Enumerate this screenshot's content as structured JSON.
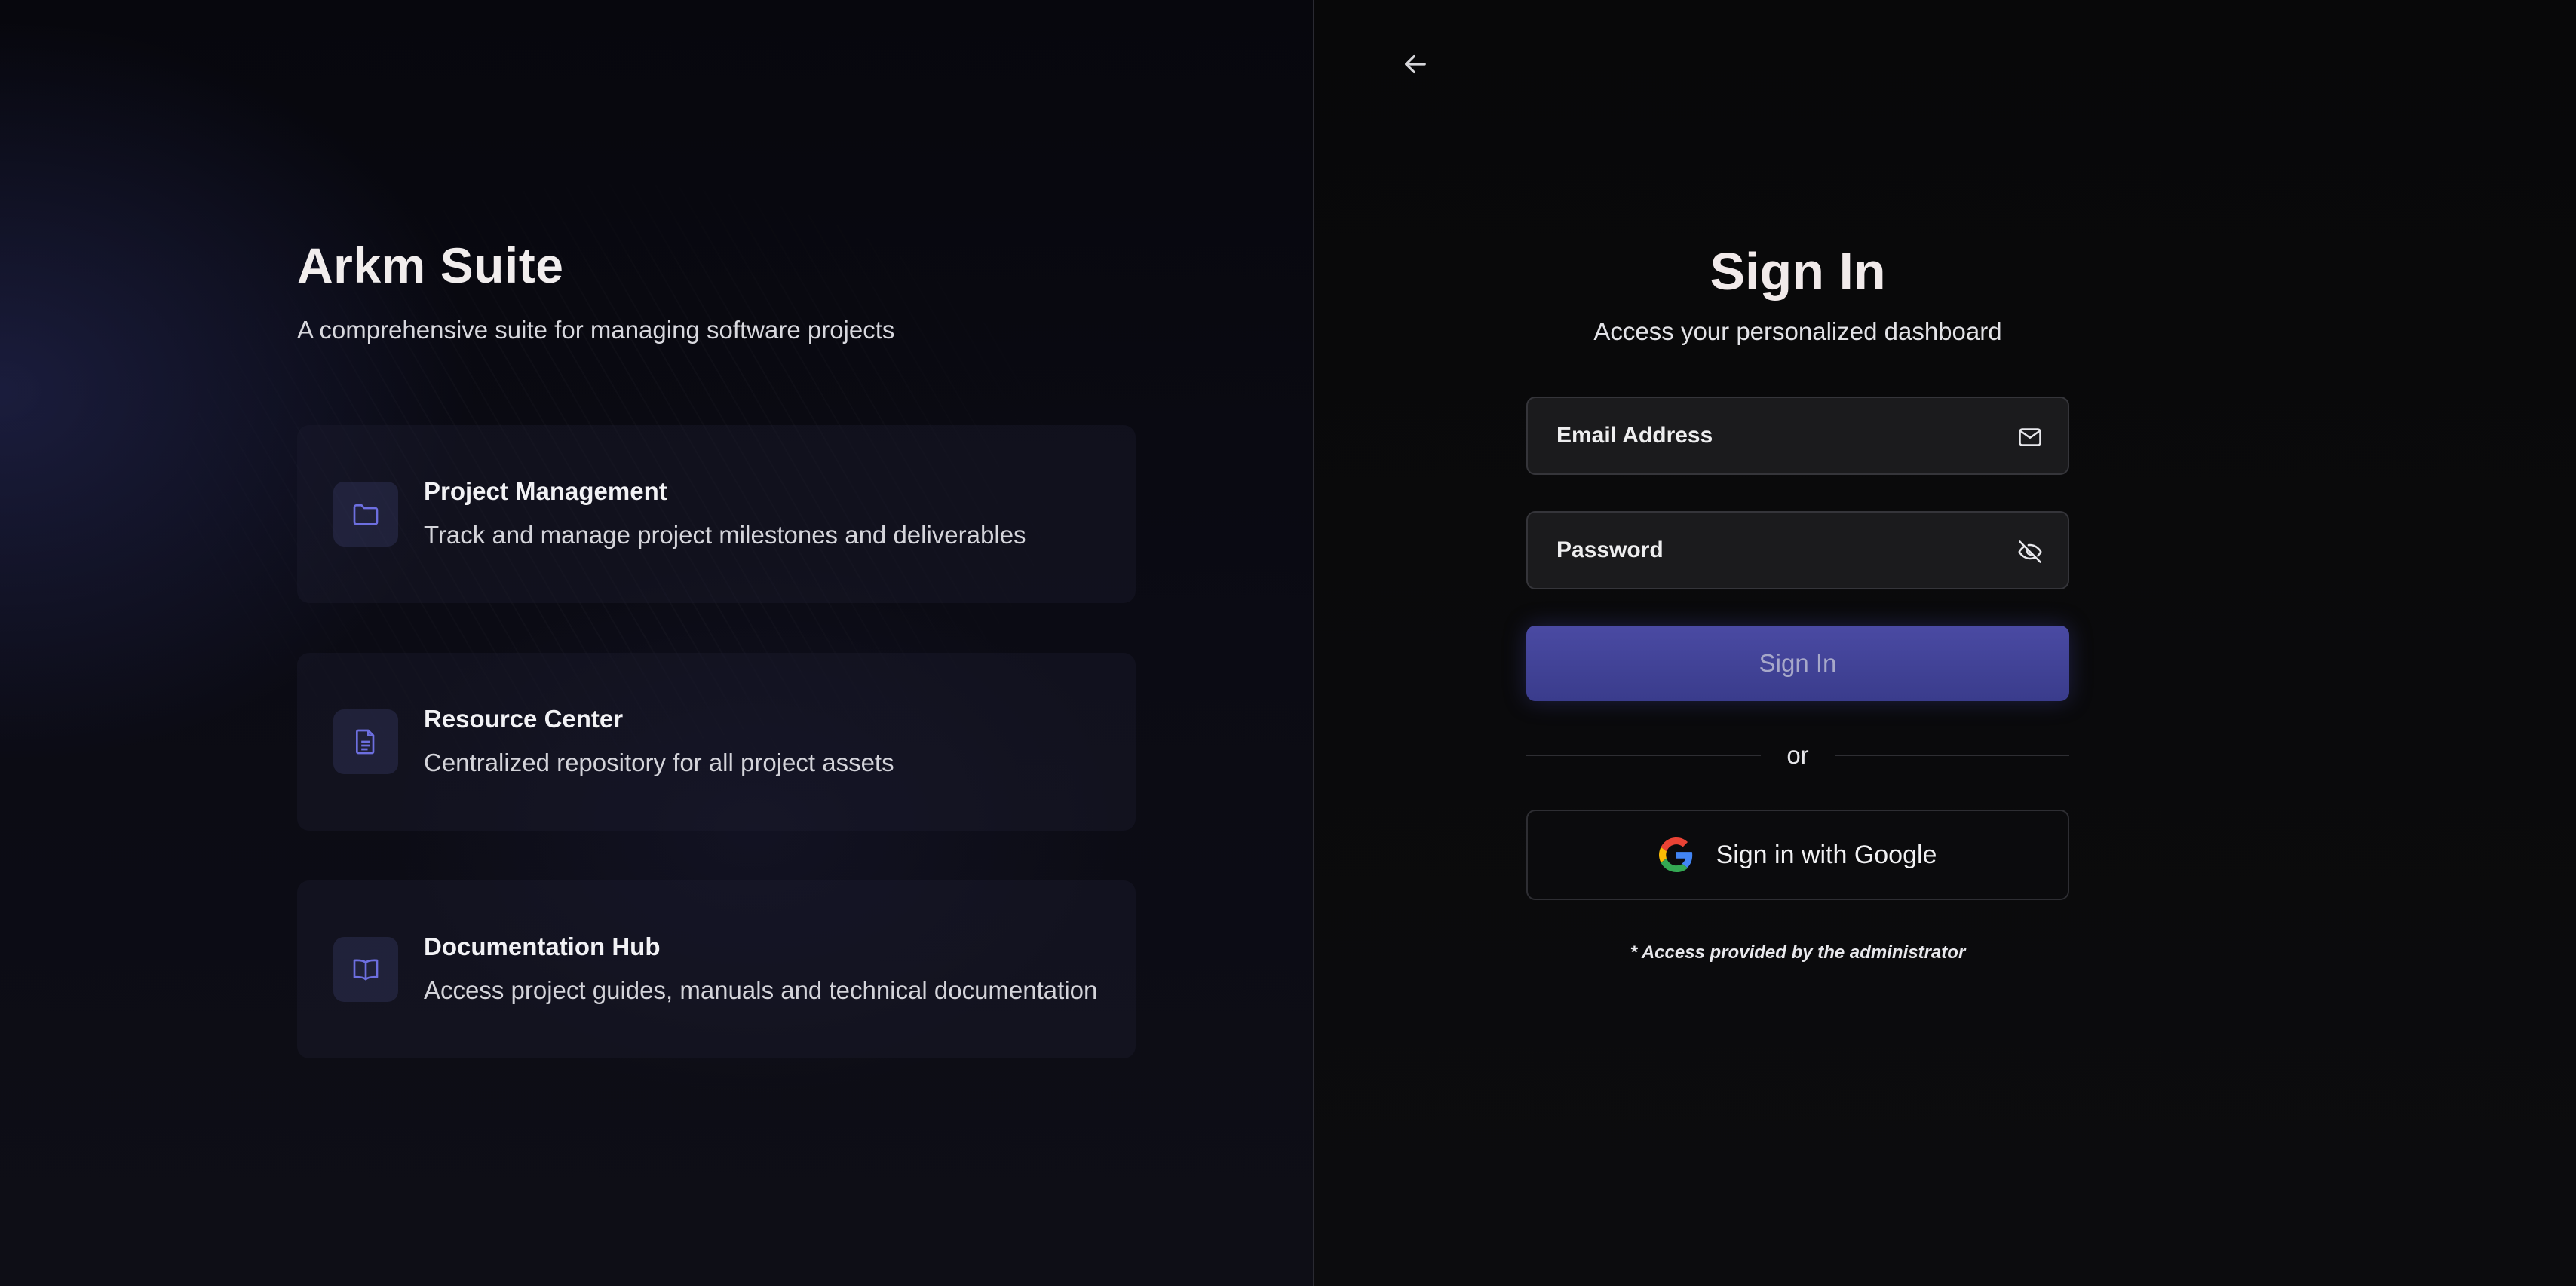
{
  "brand": {
    "title": "Arkm Suite",
    "subtitle": "A comprehensive suite for managing software projects"
  },
  "features": [
    {
      "icon": "folder-icon",
      "title": "Project Management",
      "description": "Track and manage project milestones and deliverables"
    },
    {
      "icon": "document-icon",
      "title": "Resource Center",
      "description": "Centralized repository for all project assets"
    },
    {
      "icon": "book-open-icon",
      "title": "Documentation Hub",
      "description": "Access project guides, manuals and technical documentation"
    }
  ],
  "auth": {
    "back_icon": "arrow-left-icon",
    "title": "Sign In",
    "subtitle": "Access your personalized dashboard",
    "email": {
      "placeholder": "Email Address",
      "value": "",
      "icon": "mail-icon"
    },
    "password": {
      "placeholder": "Password",
      "value": "",
      "icon": "eye-off-icon"
    },
    "signin_label": "Sign In",
    "divider_label": "or",
    "google_label": "Sign in with Google",
    "note": "* Access provided by the administrator"
  },
  "colors": {
    "accent": "#3f41966",
    "icon_accent": "#6d6fe0",
    "panel_bg": "#0a0a0c",
    "field_bg": "#1b1b1d"
  }
}
